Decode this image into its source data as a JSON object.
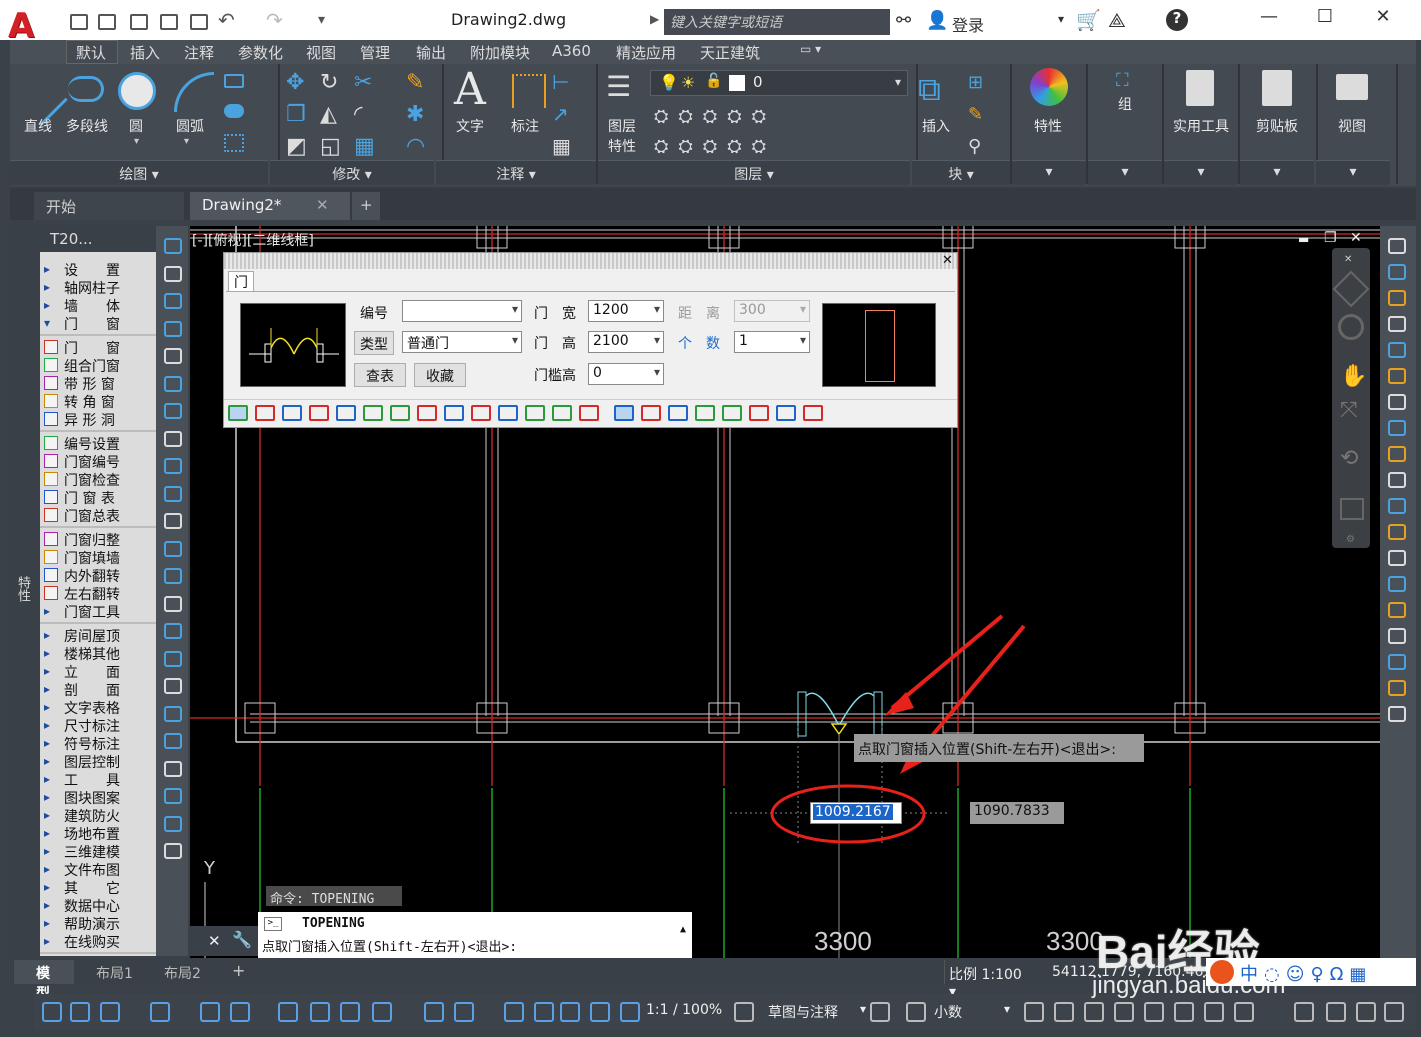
{
  "app": {
    "document_title": "Drawing2.dwg",
    "search_placeholder": "键入关键字或短语",
    "login_label": "登录"
  },
  "menu_tabs": [
    "默认",
    "插入",
    "注释",
    "参数化",
    "视图",
    "管理",
    "输出",
    "附加模块",
    "A360",
    "精选应用",
    "天正建筑"
  ],
  "ribbon": {
    "draw_tools": [
      "直线",
      "多段线",
      "圆",
      "圆弧"
    ],
    "text_label": "文字",
    "dim_label": "标注",
    "layer_props_label": "图层\n特性",
    "layer_props_line1": "图层",
    "layer_props_line2": "特性",
    "layer_value": "0",
    "insert_label": "插入",
    "properties_label": "特性",
    "group_label": "组",
    "utilities_label": "实用工具",
    "clipboard_label": "剪贴板",
    "view_label": "视图",
    "panels": [
      "绘图",
      "修改",
      "注释",
      "图层",
      "块"
    ]
  },
  "doc_tabs": {
    "start": "开始",
    "drawing": "Drawing2*",
    "add": "+"
  },
  "palette": {
    "title": "T20...",
    "side_label": "特性",
    "groups": [
      [
        "设　　置",
        "轴网柱子",
        "墙　　体",
        "门　　窗"
      ],
      [
        "门　　窗",
        "组合门窗",
        "带 形 窗",
        "转 角 窗",
        "异 形 洞"
      ],
      [
        "编号设置",
        "门窗编号",
        "门窗检查",
        "门 窗 表",
        "门窗总表"
      ],
      [
        "门窗归整",
        "门窗填墙",
        "内外翻转",
        "左右翻转",
        "门窗工具"
      ],
      [
        "房间屋顶",
        "楼梯其他",
        "立　　面",
        "剖　　面",
        "文字表格",
        "尺寸标注",
        "符号标注",
        "图层控制",
        "工　　具",
        "图块图案",
        "建筑防火",
        "场地布置",
        "三维建模",
        "文件布图",
        "其　　它",
        "数据中心",
        "帮助演示",
        "在线购买"
      ]
    ]
  },
  "viewport_label": "[-][俯视][二维线框]",
  "door_dialog": {
    "title": "门",
    "number_label": "编号",
    "number_value": "",
    "type_button": "类型",
    "type_value": "普通门",
    "lookup_button": "查表",
    "favorite_button": "收藏",
    "width_label": "门　宽",
    "width_value": "1200",
    "height_label": "门　高",
    "height_value": "2100",
    "sill_label": "门槛高",
    "sill_value": "0",
    "distance_label": "距　离",
    "distance_value": "300",
    "count_label": "个　数",
    "count_value": "1"
  },
  "drawing": {
    "tooltip": "点取门窗插入位置(Shift-左右开)<退出>:",
    "input_left": "1009.2167",
    "input_right": "1090.7833",
    "dim_a": "3300",
    "dim_b": "3300",
    "axis_y": "Y"
  },
  "command": {
    "history": "命令:  TOPENING",
    "line1": "TOPENING",
    "line2": "点取门窗插入位置(Shift-左右开)<退出>:"
  },
  "layout_tabs": [
    "模型",
    "布局1",
    "布局2"
  ],
  "status": {
    "scale": "比例 1:100",
    "coords": "54112.1779, 7160.4690,",
    "annot_scale": "1:1 / 100%",
    "workspace": "草图与注释",
    "units": "小数"
  },
  "watermark": {
    "brand": "Bai经验",
    "url": "jingyan.baidu.com"
  },
  "colors": {
    "accent_red": "#e8221b",
    "door_cyan": "#7fd8e8",
    "highlight_blue": "#1c64c8"
  }
}
